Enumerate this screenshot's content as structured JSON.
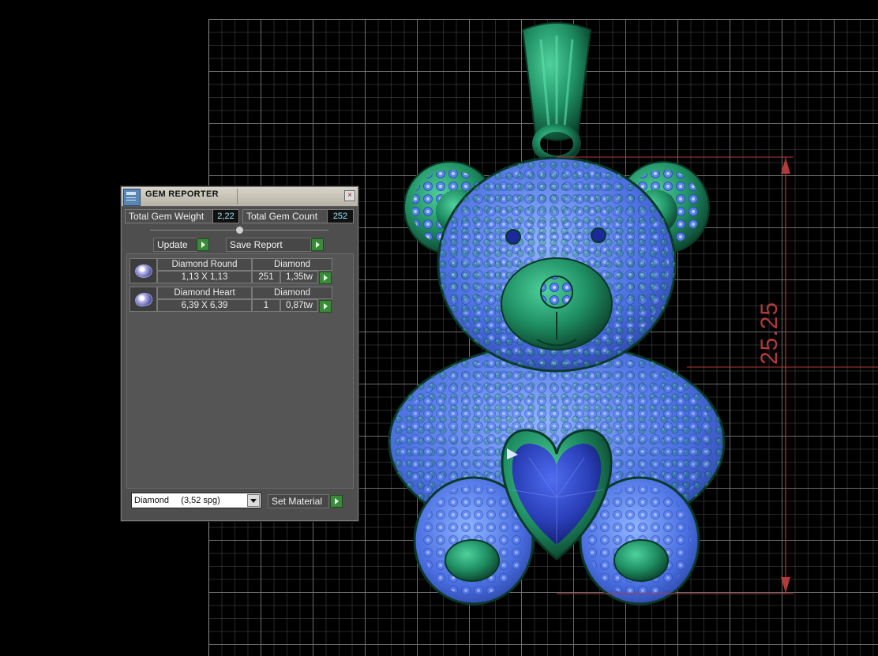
{
  "panel": {
    "title": "GEM REPORTER",
    "close_glyph": "×",
    "total_weight_label": "Total Gem Weight",
    "total_weight_value": "2,22",
    "total_count_label": "Total Gem Count",
    "total_count_value": "252",
    "update_label": "Update",
    "save_report_label": "Save Report",
    "gems": [
      {
        "name": "Diamond Round",
        "material": "Diamond",
        "size": "1,13 X 1,13",
        "count": "251",
        "weight": "1,35tw",
        "icon": "round-gem-icon"
      },
      {
        "name": "Diamond Heart",
        "material": "Diamond",
        "size": "6,39 X 6,39",
        "count": "1",
        "weight": "0,87tw",
        "icon": "heart-gem-icon"
      }
    ],
    "material_select": "Diamond     (3,52 spg)",
    "set_material_label": "Set Material"
  },
  "viewport": {
    "dimension_label": "25.25"
  },
  "colors": {
    "metal": "#1f8f63",
    "pave": "#4a6fe0",
    "heart_stone": "#2a3fb8",
    "dimension": "#b23a3a",
    "grid": "#787878"
  }
}
